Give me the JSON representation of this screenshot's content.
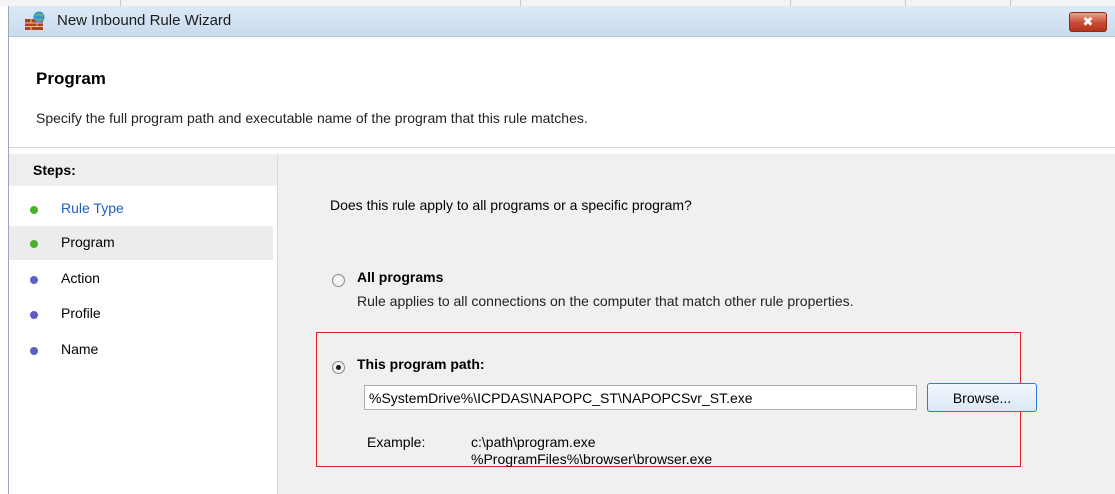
{
  "window": {
    "title": "New Inbound Rule Wizard",
    "close_label": "✖"
  },
  "header": {
    "title": "Program",
    "description": "Specify the full program path and executable name of the program that this rule matches."
  },
  "steps": {
    "title": "Steps:",
    "items": [
      {
        "label": "Rule Type",
        "dot_color": "#4caf2a",
        "text_color": "#1f5fbf",
        "state": "completed"
      },
      {
        "label": "Program",
        "dot_color": "#4caf2a",
        "text_color": "#000000",
        "state": "current"
      },
      {
        "label": "Action",
        "dot_color": "#5c5fc8",
        "text_color": "#000000",
        "state": "pending"
      },
      {
        "label": "Profile",
        "dot_color": "#5c5fc8",
        "text_color": "#000000",
        "state": "pending"
      },
      {
        "label": "Name",
        "dot_color": "#5c5fc8",
        "text_color": "#000000",
        "state": "pending"
      }
    ]
  },
  "content": {
    "question": "Does this rule apply to all programs or a specific program?",
    "options": [
      {
        "label": "All programs",
        "description": "Rule applies to all connections on the computer that match other rule properties.",
        "selected": false
      },
      {
        "label": "This program path:",
        "selected": true
      }
    ],
    "path_value": "%SystemDrive%\\ICPDAS\\NAPOPC_ST\\NAPOPCSvr_ST.exe",
    "browse_label": "Browse...",
    "example_label": "Example:",
    "example_lines": [
      "c:\\path\\program.exe",
      "%ProgramFiles%\\browser\\browser.exe"
    ]
  },
  "colors": {
    "highlight_border": "#e02020",
    "titlebar": "#c9dbee"
  }
}
